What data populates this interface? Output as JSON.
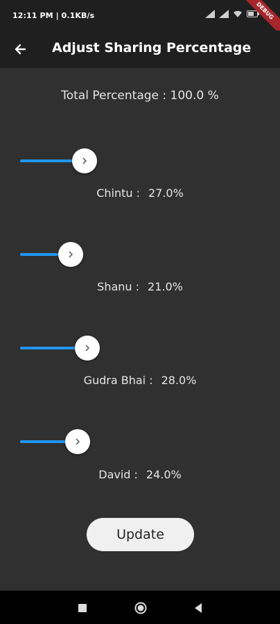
{
  "status_bar": {
    "time_info": "12:11 PM | 0.1KB/s",
    "debug_banner": "DEBUG"
  },
  "app_bar": {
    "title": "Adjust Sharing Percentage"
  },
  "total": {
    "text": "Total Percentage : 100.0 %"
  },
  "members": [
    {
      "name": "Chintu :",
      "percent_label": "27.0%",
      "percent": 27.0
    },
    {
      "name": "Shanu :",
      "percent_label": "21.0%",
      "percent": 21.0
    },
    {
      "name": "Gudra Bhai :",
      "percent_label": "28.0%",
      "percent": 28.0
    },
    {
      "name": "David :",
      "percent_label": "24.0%",
      "percent": 24.0
    }
  ],
  "update_button": {
    "label": "Update"
  },
  "colors": {
    "accent": "#2196f3",
    "background": "#303030",
    "app_bar": "#1f1f1f"
  }
}
